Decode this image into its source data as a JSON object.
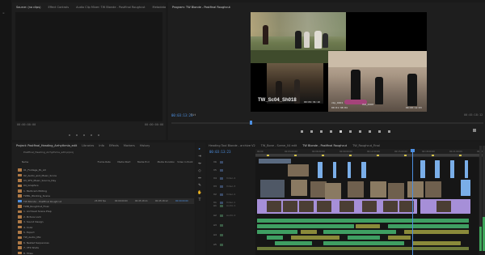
{
  "source_panel": {
    "tabs": [
      "Source: (no clips)",
      "Effect Controls",
      "Audio Clip Mixer: TW Blonde - Postfinal Roughcut",
      "Metadata"
    ],
    "timecode_left": "00:00:00:00",
    "timecode_right": "00:00:00:00"
  },
  "program_panel": {
    "tab": "Program: TW Blonde - Postfinal Roughcut",
    "timecode": "00:03:13:23",
    "fit_label": "Fit",
    "duration": "00:45:18:12",
    "frame": {
      "caption": "TW_Sc04_Sh018",
      "tile_labels": [
        "clip_0001",
        "ISO_DOM"
      ],
      "tile_timecodes": [
        "00:09:36:10",
        "00:01:38:04",
        "00:00:12:03"
      ]
    }
  },
  "project_panel": {
    "tabs": [
      "Project: Postfinal_Heading_Arrhythmia_edit",
      "Libraries",
      "Info",
      "Effects",
      "Markers",
      "History"
    ],
    "path": "Postfinal_Heading_Arrhythmia_edit.prproj",
    "columns": [
      "Name",
      "Frame Rate",
      "Media Start",
      "Media End",
      "Media Duration",
      "Video In Point"
    ],
    "rows": [
      {
        "name": "01_Footage_PL_All",
        "folder": true
      },
      {
        "name": "02_Audio_and_Music_Score",
        "folder": true
      },
      {
        "name": "03_SFX_Music_Source_Day",
        "folder": true
      },
      {
        "name": "04_Graphics",
        "folder": true
      },
      {
        "name": "1. Multicam Editing",
        "folder": true
      },
      {
        "name": "TWBL_Working_Scene",
        "folder": true
      },
      {
        "name": "TW Blonde - Postfinal Roughcut",
        "folder": false,
        "frame_rate": "23.976 fps",
        "media_start": "00:00:00:00",
        "media_end": "00:45:18:11",
        "duration": "00:45:18:12",
        "video_in": "00:00:00:00"
      },
      {
        "name": "TWB_RoughCut_Final",
        "folder": true
      },
      {
        "name": "1. Archived Scene Prep",
        "folder": true
      },
      {
        "name": "2. Picture Lock",
        "folder": true
      },
      {
        "name": "3. Sound Design",
        "folder": true
      },
      {
        "name": "4. Color",
        "folder": true
      },
      {
        "name": "5. Export",
        "folder": true
      },
      {
        "name": "TW_Audio_Mix",
        "folder": true
      },
      {
        "name": "6. Nested Sequences",
        "folder": true
      },
      {
        "name": "7. VFX Shots",
        "folder": true
      },
      {
        "name": "8. Titles",
        "folder": true
      }
    ]
  },
  "timeline_panel": {
    "tabs": [
      "Heading Tool Blonde - archive V2",
      "TW_Bone - Scene_04 edit",
      "TW Blonde - Postfinal Roughcut",
      "TW_Roughcut_Final"
    ],
    "timecode": "00:03:13:23",
    "tracks": [
      "V6",
      "V5",
      "V4",
      "V3",
      "V2",
      "V1",
      "A1",
      "A2",
      "A3",
      "A4",
      "A5"
    ],
    "track_labels": [
      "Video 4",
      "Video 3",
      "Video 2",
      "Video 1",
      "Audio 1",
      "Audio 2"
    ],
    "ruler_times": [
      "00:00",
      "00:03:00:00",
      "00:06:00:00",
      "00:09:00:00",
      "00:12:00:00",
      "00:15:00:00",
      "00:18:00:00",
      "00:21:00:00",
      "00:24:00:00"
    ]
  },
  "colors": {
    "accent_blue": "#4d8fe0",
    "video_clip_blue": "#7aaee8",
    "video_clip_purple": "#a68fd8",
    "audio_clip_green": "#3f9e62",
    "folder": "#b07a46",
    "playhead": "#4d8fe0"
  }
}
